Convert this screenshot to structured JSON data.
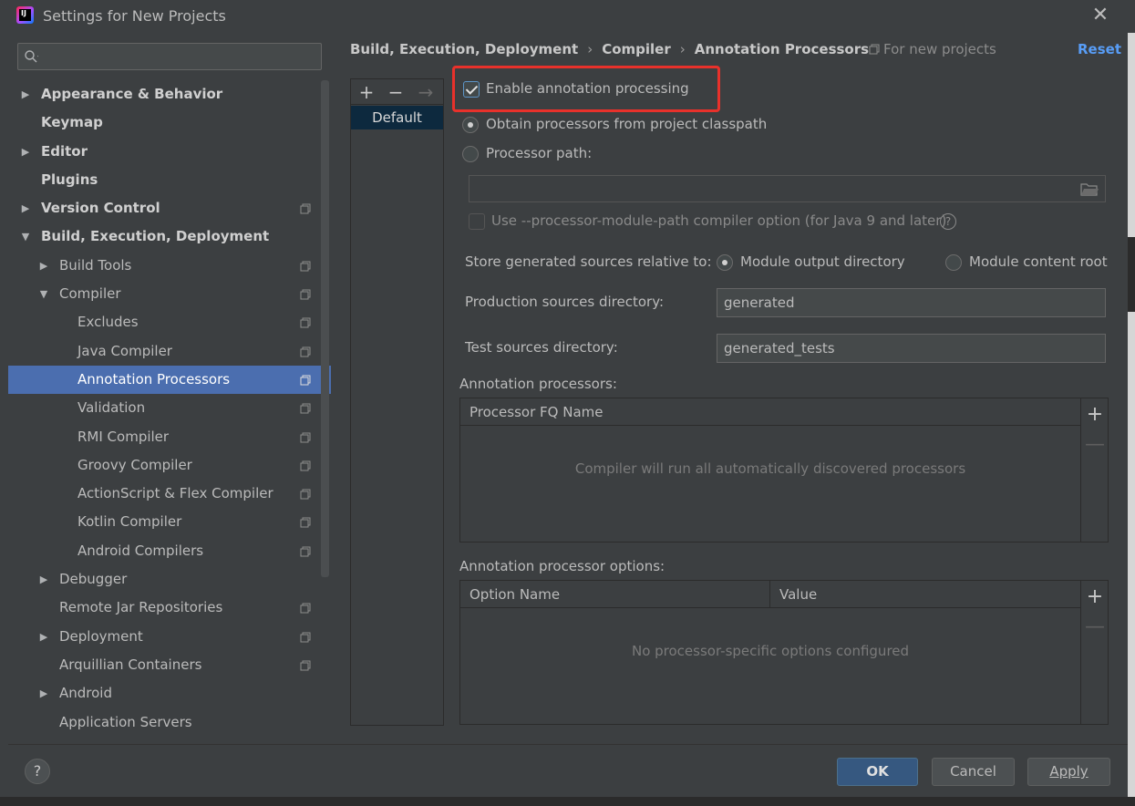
{
  "window": {
    "title": "Settings for New Projects",
    "close_glyph": "✕"
  },
  "search": {
    "placeholder": "",
    "value": ""
  },
  "tree": [
    {
      "label": "Appearance & Behavior",
      "level": 0,
      "expander": "collapsed",
      "bold": true,
      "project_icon": false
    },
    {
      "label": "Keymap",
      "level": 0,
      "expander": "none",
      "bold": true,
      "project_icon": false
    },
    {
      "label": "Editor",
      "level": 0,
      "expander": "collapsed",
      "bold": true,
      "project_icon": false
    },
    {
      "label": "Plugins",
      "level": 0,
      "expander": "none",
      "bold": true,
      "project_icon": false
    },
    {
      "label": "Version Control",
      "level": 0,
      "expander": "collapsed",
      "bold": true,
      "project_icon": true
    },
    {
      "label": "Build, Execution, Deployment",
      "level": 0,
      "expander": "expanded",
      "bold": true,
      "project_icon": false
    },
    {
      "label": "Build Tools",
      "level": 1,
      "expander": "collapsed",
      "bold": false,
      "project_icon": true
    },
    {
      "label": "Compiler",
      "level": 1,
      "expander": "expanded",
      "bold": false,
      "project_icon": true
    },
    {
      "label": "Excludes",
      "level": 2,
      "expander": "none",
      "bold": false,
      "project_icon": true
    },
    {
      "label": "Java Compiler",
      "level": 2,
      "expander": "none",
      "bold": false,
      "project_icon": true
    },
    {
      "label": "Annotation Processors",
      "level": 2,
      "expander": "none",
      "bold": false,
      "project_icon": true,
      "selected": true
    },
    {
      "label": "Validation",
      "level": 2,
      "expander": "none",
      "bold": false,
      "project_icon": true
    },
    {
      "label": "RMI Compiler",
      "level": 2,
      "expander": "none",
      "bold": false,
      "project_icon": true
    },
    {
      "label": "Groovy Compiler",
      "level": 2,
      "expander": "none",
      "bold": false,
      "project_icon": true
    },
    {
      "label": "ActionScript & Flex Compiler",
      "level": 2,
      "expander": "none",
      "bold": false,
      "project_icon": true
    },
    {
      "label": "Kotlin Compiler",
      "level": 2,
      "expander": "none",
      "bold": false,
      "project_icon": true
    },
    {
      "label": "Android Compilers",
      "level": 2,
      "expander": "none",
      "bold": false,
      "project_icon": true
    },
    {
      "label": "Debugger",
      "level": 1,
      "expander": "collapsed",
      "bold": false,
      "project_icon": false
    },
    {
      "label": "Remote Jar Repositories",
      "level": 1,
      "expander": "none",
      "bold": false,
      "project_icon": true
    },
    {
      "label": "Deployment",
      "level": 1,
      "expander": "collapsed",
      "bold": false,
      "project_icon": true
    },
    {
      "label": "Arquillian Containers",
      "level": 1,
      "expander": "none",
      "bold": false,
      "project_icon": true
    },
    {
      "label": "Android",
      "level": 1,
      "expander": "collapsed",
      "bold": false,
      "project_icon": false
    },
    {
      "label": "Application Servers",
      "level": 1,
      "expander": "none",
      "bold": false,
      "project_icon": false
    }
  ],
  "breadcrumb": [
    "Build, Execution, Deployment",
    "Compiler",
    "Annotation Processors"
  ],
  "breadcrumb_sep": "›",
  "for_new_projects": "For new projects",
  "reset_label": "Reset",
  "profiles": {
    "toolbar": {
      "add": "+",
      "remove": "−",
      "move": "→"
    },
    "items": [
      "Default"
    ]
  },
  "options": {
    "enable_processing": {
      "label": "Enable annotation processing",
      "checked": true
    },
    "obtain_from_classpath": {
      "label": "Obtain processors from project classpath",
      "selected": true
    },
    "processor_path": {
      "label": "Processor path:",
      "selected": false,
      "value": ""
    },
    "module_path": {
      "label": "Use --processor-module-path compiler option (for Java 9 and later)",
      "checked": false,
      "help": "?"
    },
    "store_relative": {
      "label": "Store generated sources relative to:",
      "choices": [
        "Module output directory",
        "Module content root"
      ],
      "selected": "Module output directory"
    },
    "production_dir": {
      "label": "Production sources directory:",
      "value": "generated"
    },
    "test_dir": {
      "label": "Test sources directory:",
      "value": "generated_tests"
    }
  },
  "processors_table": {
    "title": "Annotation processors:",
    "columns": [
      "Processor FQ Name"
    ],
    "empty_text": "Compiler will run all automatically discovered processors",
    "add": "+",
    "remove": "—"
  },
  "options_table": {
    "title": "Annotation processor options:",
    "columns": [
      "Option Name",
      "Value"
    ],
    "empty_text": "No processor-specific options configured",
    "add": "+",
    "remove": "—"
  },
  "footer": {
    "help": "?",
    "ok": "OK",
    "cancel": "Cancel",
    "apply": "Apply"
  },
  "colors": {
    "background": "#3c3f41",
    "selection": "#4b6eaf",
    "primary_button": "#365880",
    "link": "#589df6",
    "highlight_box": "#e8312b"
  }
}
